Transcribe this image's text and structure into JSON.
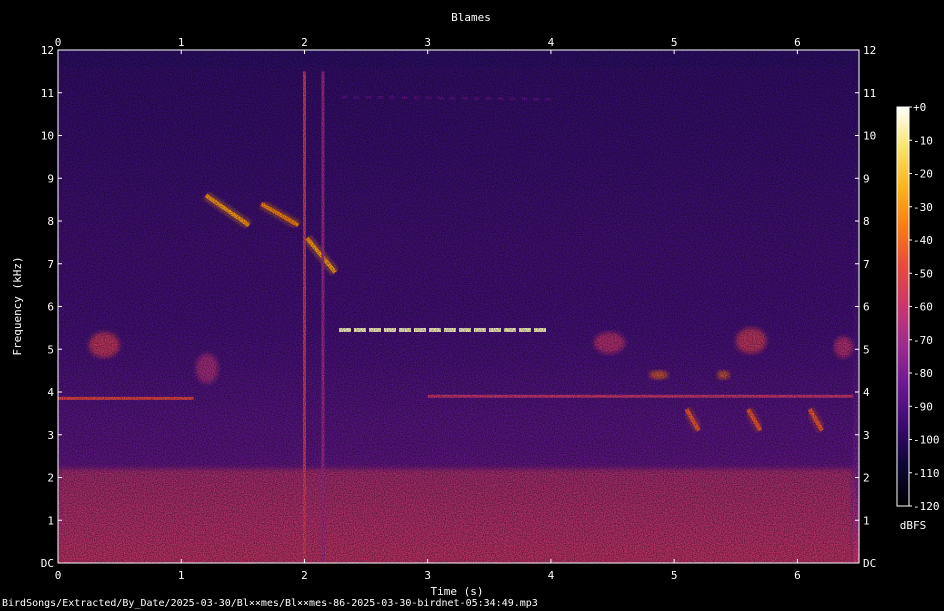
{
  "chart_data": {
    "type": "heatmap",
    "title": "Blames",
    "xlabel": "Time (s)",
    "ylabel": "Frequency (kHz)",
    "xlim": [
      0,
      6.5
    ],
    "ylim": [
      0,
      12
    ],
    "x_ticks": [
      "0",
      "1",
      "2",
      "3",
      "4",
      "5",
      "6"
    ],
    "x_tick_values": [
      0,
      1,
      2,
      3,
      4,
      5,
      6
    ],
    "y_ticks": [
      "DC",
      "1",
      "2",
      "3",
      "4",
      "5",
      "6",
      "7",
      "8",
      "9",
      "10",
      "11",
      "12"
    ],
    "y_tick_values": [
      0,
      1,
      2,
      3,
      4,
      5,
      6,
      7,
      8,
      9,
      10,
      11,
      12
    ],
    "colorbar": {
      "label": "dBFS",
      "ticks": [
        "+0",
        "-10",
        "-20",
        "-30",
        "-40",
        "-50",
        "-60",
        "-70",
        "-80",
        "-90",
        "-100",
        "-110",
        "-120"
      ],
      "tick_values": [
        0,
        -10,
        -20,
        -30,
        -40,
        -50,
        -60,
        -70,
        -80,
        -90,
        -100,
        -110,
        -120
      ],
      "range": [
        -120,
        0
      ],
      "colors": [
        "#000000",
        "#0b0633",
        "#3a0a6e",
        "#6a1791",
        "#9b2b8f",
        "#c9366f",
        "#e8493c",
        "#f97c14",
        "#fbb41c",
        "#f7e46c",
        "#ffffff"
      ]
    },
    "features": [
      {
        "kind": "noise-floor",
        "t": [
          0,
          6.45
        ],
        "f": [
          0,
          11.6
        ],
        "level_dbfs": -95
      },
      {
        "kind": "low-frequency-energy",
        "t": [
          0,
          6.45
        ],
        "f": [
          0,
          2.2
        ],
        "level_dbfs": -55
      },
      {
        "kind": "tone",
        "t": [
          0,
          1.1
        ],
        "f": [
          3.85,
          3.85
        ],
        "level_dbfs": -50
      },
      {
        "kind": "tone",
        "t": [
          3.0,
          6.45
        ],
        "f": [
          3.9,
          3.9
        ],
        "level_dbfs": -60
      },
      {
        "kind": "sweep",
        "t": [
          1.2,
          1.55
        ],
        "f": [
          8.6,
          7.9
        ],
        "level_dbfs": -30
      },
      {
        "kind": "sweep",
        "t": [
          1.65,
          1.95
        ],
        "f": [
          8.4,
          7.9
        ],
        "level_dbfs": -35
      },
      {
        "kind": "sweep",
        "t": [
          2.02,
          2.25
        ],
        "f": [
          7.6,
          6.8
        ],
        "level_dbfs": -30
      },
      {
        "kind": "trill",
        "t": [
          2.28,
          3.98
        ],
        "f": [
          5.45,
          5.45
        ],
        "level_dbfs": -5
      },
      {
        "kind": "trill-harmonic",
        "t": [
          2.3,
          4.0
        ],
        "f": [
          10.9,
          10.85
        ],
        "level_dbfs": -90
      },
      {
        "kind": "click",
        "t": [
          2.0,
          2.0
        ],
        "f": [
          0,
          11.5
        ],
        "level_dbfs": -55
      },
      {
        "kind": "click",
        "t": [
          2.15,
          2.15
        ],
        "f": [
          0,
          11.5
        ],
        "level_dbfs": -70
      },
      {
        "kind": "blob",
        "t": [
          0.25,
          0.5
        ],
        "f": [
          4.8,
          5.4
        ],
        "level_dbfs": -55
      },
      {
        "kind": "blob",
        "t": [
          1.12,
          1.3
        ],
        "f": [
          4.2,
          4.9
        ],
        "level_dbfs": -65
      },
      {
        "kind": "blob",
        "t": [
          4.35,
          4.6
        ],
        "f": [
          4.9,
          5.4
        ],
        "level_dbfs": -60
      },
      {
        "kind": "blob",
        "t": [
          4.8,
          4.95
        ],
        "f": [
          4.3,
          4.5
        ],
        "level_dbfs": -40
      },
      {
        "kind": "blob",
        "t": [
          5.35,
          5.45
        ],
        "f": [
          4.3,
          4.5
        ],
        "level_dbfs": -40
      },
      {
        "kind": "blob",
        "t": [
          5.5,
          5.75
        ],
        "f": [
          4.9,
          5.5
        ],
        "level_dbfs": -55
      },
      {
        "kind": "blob",
        "t": [
          6.3,
          6.45
        ],
        "f": [
          4.8,
          5.3
        ],
        "level_dbfs": -60
      },
      {
        "kind": "chirp",
        "t": [
          5.1,
          5.2
        ],
        "f": [
          3.6,
          3.1
        ],
        "level_dbfs": -45
      },
      {
        "kind": "chirp",
        "t": [
          5.6,
          5.7
        ],
        "f": [
          3.6,
          3.1
        ],
        "level_dbfs": -45
      },
      {
        "kind": "chirp",
        "t": [
          6.1,
          6.2
        ],
        "f": [
          3.6,
          3.1
        ],
        "level_dbfs": -45
      }
    ]
  },
  "footer": {
    "path": "BirdSongs/Extracted/By_Date/2025-03-30/Bl××mes/Bl××mes-86-2025-03-30-birdnet-05:34:49.mp3"
  }
}
